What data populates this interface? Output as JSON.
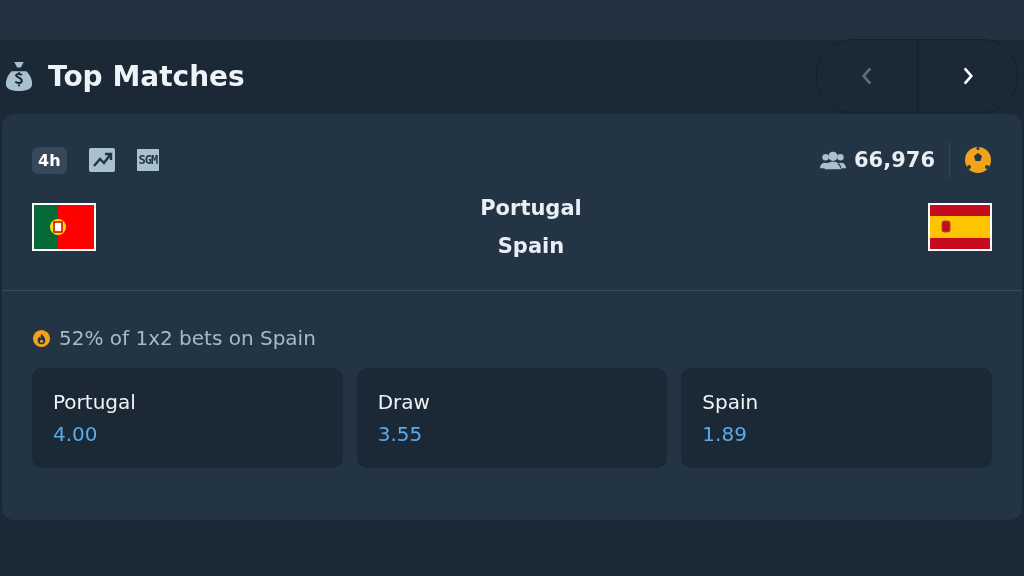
{
  "header": {
    "title": "Top Matches",
    "nav": [
      {
        "kind": "prev",
        "disabled": true
      },
      {
        "kind": "next",
        "disabled": false
      }
    ]
  },
  "match": {
    "badges": [
      {
        "kind": "text",
        "label": "4h"
      },
      {
        "kind": "trend"
      },
      {
        "kind": "text-icon",
        "label": "SGM"
      }
    ],
    "viewers": "66,976",
    "home": {
      "name": "Portugal"
    },
    "away": {
      "name": "Spain"
    },
    "bet_share": "52% of 1x2 bets on Spain",
    "odds": [
      {
        "label": "Portugal",
        "price": "4.00"
      },
      {
        "label": "Draw",
        "price": "3.55"
      },
      {
        "label": "Spain",
        "price": "1.89"
      }
    ]
  }
}
